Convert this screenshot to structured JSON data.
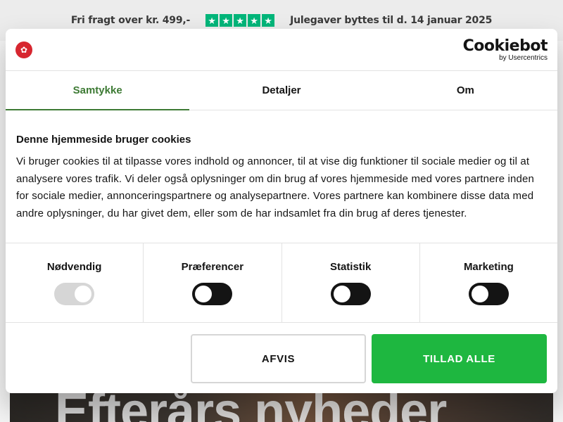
{
  "topbar": {
    "shipping": "Fri fragt over kr. 499,-",
    "rating_icon": "trustpilot-stars-icon",
    "rating_color": "#00b67a",
    "gifts": "Julegaver byttes til d. 14 januar 2025"
  },
  "hero": {
    "text": "Efterårs nyheder"
  },
  "dialog": {
    "logo_icon": "maple-leaf-logo-icon",
    "provider": {
      "name": "Cookiebot",
      "sub": "by Usercentrics"
    },
    "tabs": [
      {
        "label": "Samtykke",
        "active": true
      },
      {
        "label": "Detaljer",
        "active": false
      },
      {
        "label": "Om",
        "active": false
      }
    ],
    "heading": "Denne hjemmeside bruger cookies",
    "body": "Vi bruger cookies til at tilpasse vores indhold og annoncer, til at vise dig funktioner til sociale medier og til at analysere vores trafik. Vi deler også oplysninger om din brug af vores hjemmeside med vores partnere inden for sociale medier, annonceringspartnere og analysepartnere. Vores partnere kan kombinere disse data med andre oplysninger, du har givet dem, eller som de har indsamlet fra din brug af deres tjenester.",
    "toggles": [
      {
        "label": "Nødvendig",
        "state": "on-locked"
      },
      {
        "label": "Præferencer",
        "state": "off"
      },
      {
        "label": "Statistik",
        "state": "off"
      },
      {
        "label": "Marketing",
        "state": "off"
      }
    ],
    "buttons": {
      "decline": "AFVIS",
      "allow": "TILLAD ALLE"
    },
    "accent_color": "#3d7a34",
    "allow_color": "#1eb740"
  }
}
